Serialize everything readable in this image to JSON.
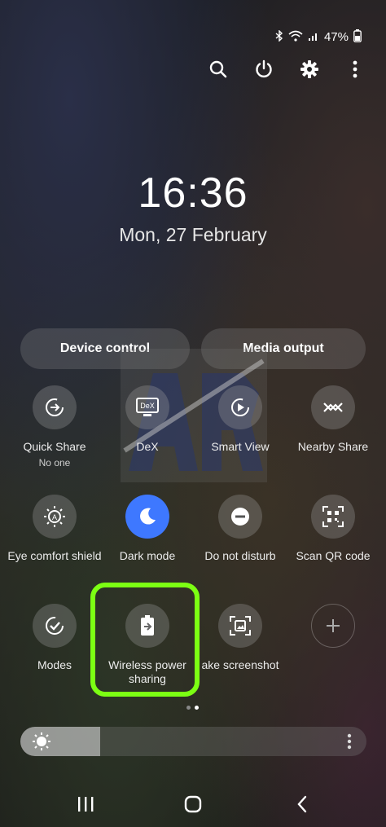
{
  "status": {
    "battery": "47%",
    "icons": [
      "bluetooth-icon",
      "wifi-icon",
      "signal-icon",
      "battery-icon"
    ]
  },
  "actions": [
    "search-icon",
    "power-icon",
    "settings-icon",
    "more-vertical-icon"
  ],
  "clock": {
    "time": "16:36",
    "date": "Mon, 27 February"
  },
  "pills": {
    "device_control": "Device control",
    "media_output": "Media output"
  },
  "watermark": "AR",
  "tiles": [
    {
      "label": "Quick Share",
      "sub": "No one",
      "icon": "quick-share-icon",
      "active": false
    },
    {
      "label": "DeX",
      "sub": "",
      "icon": "dex-icon",
      "active": false
    },
    {
      "label": "Smart View",
      "sub": "",
      "icon": "smart-view-icon",
      "active": false
    },
    {
      "label": "Nearby Share",
      "sub": "",
      "icon": "nearby-share-icon",
      "active": false
    },
    {
      "label": "Eye comfort shield",
      "sub": "",
      "icon": "eye-comfort-icon",
      "active": false
    },
    {
      "label": "Dark mode",
      "sub": "",
      "icon": "moon-icon",
      "active": true
    },
    {
      "label": "Do not disturb",
      "sub": "",
      "icon": "dnd-icon",
      "active": false
    },
    {
      "label": "Scan QR code",
      "sub": "",
      "icon": "qr-icon",
      "active": false
    },
    {
      "label": "Modes",
      "sub": "",
      "icon": "modes-icon",
      "active": false
    },
    {
      "label": "Wireless power sharing",
      "sub": "",
      "icon": "wireless-power-icon",
      "active": false
    },
    {
      "label": "ake screenshot",
      "sub": "",
      "icon": "screenshot-icon",
      "active": false
    },
    {
      "label": "",
      "sub": "",
      "icon": "add-icon",
      "active": false
    }
  ],
  "dex_badge": "DeX",
  "brightness": {
    "level": 0.23
  },
  "pager": {
    "pages": 2,
    "current": 2
  },
  "colors": {
    "highlight": "#7cff13",
    "active_tile": "#3e78ff"
  }
}
